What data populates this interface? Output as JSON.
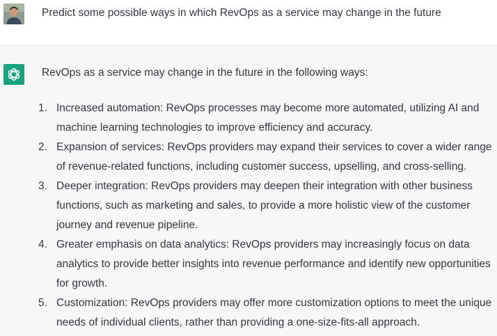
{
  "colors": {
    "assistant_bg": "#f7f7f8",
    "brand_green": "#19a37f",
    "text": "#343541"
  },
  "user_message": {
    "avatar_icon": "user-photo-avatar",
    "text": "Predict some possible ways in which RevOps as a service may change in the future"
  },
  "assistant_message": {
    "avatar_icon": "openai-logo-icon",
    "intro": "RevOps as a service may change in the future in the following ways:",
    "items": [
      {
        "number": "1.",
        "text": "Increased automation: RevOps processes may become more automated, utilizing AI and machine learning technologies to improve efficiency and accuracy."
      },
      {
        "number": "2.",
        "text": "Expansion of services: RevOps providers may expand their services to cover a wider range of revenue-related functions, including customer success, upselling, and cross-selling."
      },
      {
        "number": "3.",
        "text": "Deeper integration: RevOps providers may deepen their integration with other business functions, such as marketing and sales, to provide a more holistic view of the customer journey and revenue pipeline."
      },
      {
        "number": "4.",
        "text": "Greater emphasis on data analytics: RevOps providers may increasingly focus on data analytics to provide better insights into revenue performance and identify new opportunities for growth."
      },
      {
        "number": "5.",
        "text": "Customization: RevOps providers may offer more customization options to meet the unique needs of individual clients, rather than providing a one-size-fits-all approach."
      }
    ]
  }
}
